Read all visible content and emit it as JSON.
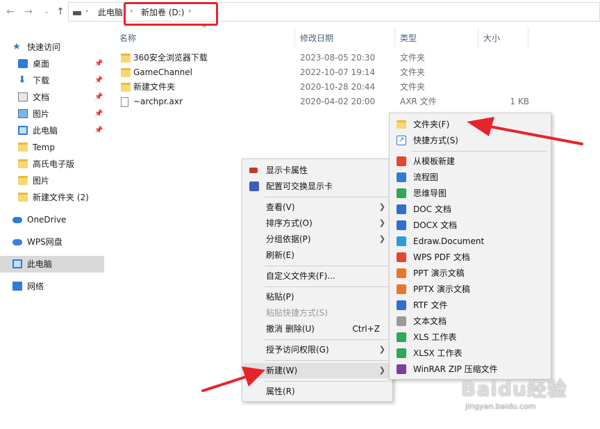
{
  "nav": {
    "back_icon": "arrow-left-icon",
    "forward_icon": "arrow-right-icon",
    "recent_icon": "chevron-down-icon",
    "up_icon": "arrow-up-icon"
  },
  "address": {
    "crumbs": [
      "此电脑",
      "新加卷 (D:)"
    ],
    "separator": "›",
    "highlight_color": "#e8242b"
  },
  "sidebar": {
    "quick_access": "快速访问",
    "items": [
      {
        "label": "桌面",
        "pinned": true
      },
      {
        "label": "下载",
        "pinned": true
      },
      {
        "label": "文档",
        "pinned": true
      },
      {
        "label": "图片",
        "pinned": true
      },
      {
        "label": "此电脑",
        "pinned": true
      },
      {
        "label": "Temp",
        "pinned": false
      },
      {
        "label": "高氏电子版",
        "pinned": false
      },
      {
        "label": "图片",
        "pinned": false
      },
      {
        "label": "新建文件夹 (2)",
        "pinned": false
      }
    ],
    "onedrive": "OneDrive",
    "wps": "WPS网盘",
    "this_pc": "此电脑",
    "network": "网络"
  },
  "columns": {
    "name": "名称",
    "date": "修改日期",
    "type": "类型",
    "size": "大小"
  },
  "files": [
    {
      "name": "360安全浏览器下载",
      "date": "2023-08-05 20:30",
      "type": "文件夹",
      "size": ""
    },
    {
      "name": "GameChannel",
      "date": "2022-10-07 19:14",
      "type": "文件夹",
      "size": ""
    },
    {
      "name": "新建文件夹",
      "date": "2020-10-28 20:44",
      "type": "文件夹",
      "size": ""
    },
    {
      "name": "~archpr.axr",
      "date": "2020-04-02 20:00",
      "type": "AXR 文件",
      "size": "1 KB"
    }
  ],
  "context_menu": {
    "display_props": "显示卡属性",
    "switchable_gfx": "配置可交换显示卡",
    "view": "查看(V)",
    "sort_by": "排序方式(O)",
    "group_by": "分组依据(P)",
    "refresh": "刷新(E)",
    "customize": "自定义文件夹(F)...",
    "paste": "粘贴(P)",
    "paste_shortcut": "粘贴快捷方式(S)",
    "undo": "撤消 删除(U)",
    "undo_shortcut": "Ctrl+Z",
    "give_access": "授予访问权限(G)",
    "new": "新建(W)",
    "properties": "属性(R)"
  },
  "new_submenu": {
    "folder": "文件夹(F)",
    "shortcut": "快捷方式(S)",
    "items": [
      {
        "label": "从模板新建",
        "color": "#e4462f"
      },
      {
        "label": "流程图",
        "color": "#2f7bd8"
      },
      {
        "label": "思维导图",
        "color": "#2fa85a"
      },
      {
        "label": "DOC 文档",
        "color": "#2f6fcf"
      },
      {
        "label": "DOCX 文档",
        "color": "#2f6fcf"
      },
      {
        "label": "Edraw.Document",
        "color": "#2f9ad8"
      },
      {
        "label": "WPS PDF 文档",
        "color": "#e4462f"
      },
      {
        "label": "PPT 演示文稿",
        "color": "#e8772e"
      },
      {
        "label": "PPTX 演示文稿",
        "color": "#e8772e"
      },
      {
        "label": "RTF 文件",
        "color": "#2f6fcf"
      },
      {
        "label": "文本文档",
        "color": "#9a9a9a"
      },
      {
        "label": "XLS 工作表",
        "color": "#2fa85a"
      },
      {
        "label": "XLSX 工作表",
        "color": "#2fa85a"
      },
      {
        "label": "WinRAR ZIP 压缩文件",
        "color": "#7a3fa0"
      }
    ]
  },
  "annotation_color": "#e8242b",
  "watermark": {
    "brand": "Baidu经验",
    "url": "jingyan.baidu.com"
  }
}
